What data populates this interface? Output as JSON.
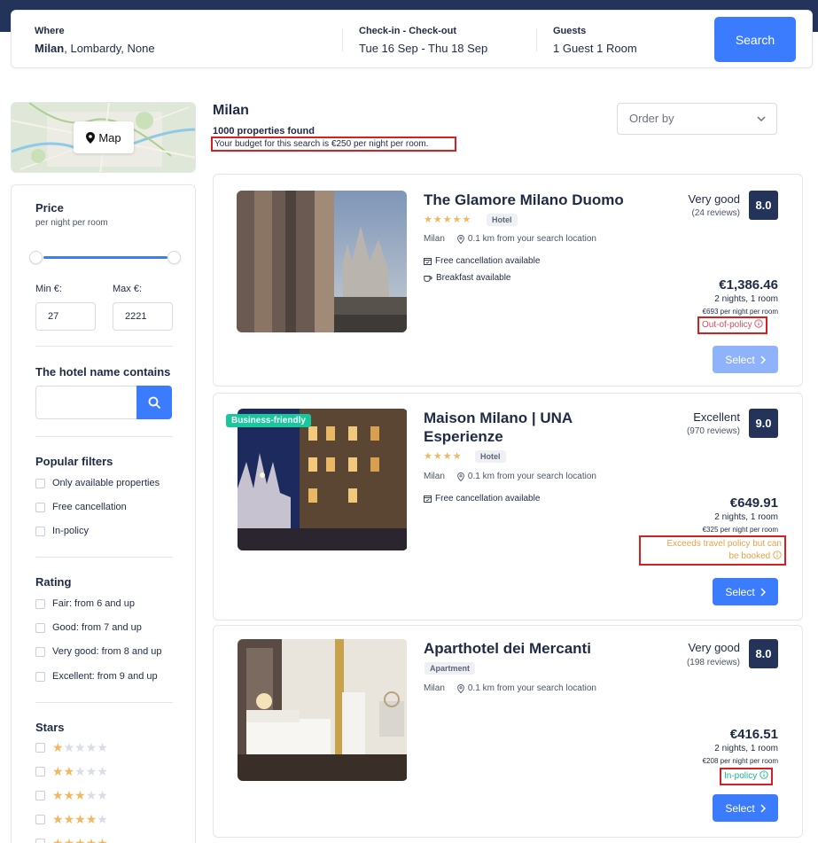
{
  "search": {
    "where_label": "Where",
    "where_city": "Milan",
    "where_rest": ", Lombardy, None",
    "dates_label": "Check-in - Check-out",
    "dates_value": "Tue 16 Sep - Thu 18 Sep",
    "guests_label": "Guests",
    "guests_value": "1 Guest 1 Room",
    "search_button": "Search"
  },
  "map": {
    "button_label": "Map",
    "icon": "map-pin-icon"
  },
  "filters": {
    "price_title": "Price",
    "price_sub": "per night per room",
    "min_label": "Min €:",
    "max_label": "Max €:",
    "min_value": "27",
    "max_value": "2221",
    "hotel_name_title": "The hotel name contains",
    "hotel_name_value": "",
    "popular_title": "Popular filters",
    "popular": [
      "Only available properties",
      "Free cancellation",
      "In-policy"
    ],
    "rating_title": "Rating",
    "ratings": [
      "Fair: from 6 and up",
      "Good: from 7 and up",
      "Very good: from 8 and up",
      "Excellent: from 9 and up"
    ],
    "stars_title": "Stars",
    "stars_levels": [
      1,
      2,
      3,
      4,
      5
    ]
  },
  "results": {
    "city": "Milan",
    "found": "1000 properties found",
    "budget_note": "Your budget for this search is €250 per night per room.",
    "order_by": "Order by"
  },
  "hotels": [
    {
      "name": "The Glamore Milano Duomo",
      "name_line2": "",
      "stars": 5,
      "type": "Hotel",
      "city": "Milan",
      "distance": "0.1 km from your search location",
      "features": [
        "Free cancellation available",
        "Breakfast available"
      ],
      "rating_word": "Very good",
      "reviews": "(24 reviews)",
      "score": "8.0",
      "total": "€1,386.46",
      "nights": "2 nights, 1 room",
      "per_night": "€693 per night per room",
      "policy_line1": "Out-of-policy",
      "policy_line2": "",
      "policy_status": "out",
      "select_label": "Select",
      "badge": ""
    },
    {
      "name": "Maison Milano | UNA",
      "name_line2": "Esperienze",
      "stars": 4,
      "type": "Hotel",
      "city": "Milan",
      "distance": "0.1 km from your search location",
      "features": [
        "Free cancellation available"
      ],
      "rating_word": "Excellent",
      "reviews": "(970 reviews)",
      "score": "9.0",
      "total": "€649.91",
      "nights": "2 nights, 1 room",
      "per_night": "€325 per night per room",
      "policy_line1": "Exceeds travel policy but can",
      "policy_line2": "be booked",
      "policy_status": "exceeds",
      "select_label": "Select",
      "badge": "Business-friendly"
    },
    {
      "name": "Aparthotel dei Mercanti",
      "name_line2": "",
      "stars": 0,
      "type": "Apartment",
      "city": "Milan",
      "distance": "0.1 km from your search location",
      "features": [],
      "rating_word": "Very good",
      "reviews": "(198 reviews)",
      "score": "8.0",
      "total": "€416.51",
      "nights": "2 nights, 1 room",
      "per_night": "€208 per night per room",
      "policy_line1": "In-policy",
      "policy_line2": "",
      "policy_status": "in",
      "select_label": "Select",
      "badge": ""
    }
  ],
  "colors": {
    "topbar": "#24335a",
    "accent": "#3b7cff",
    "score_bg": "#24335a",
    "star": "#f0b860",
    "out_of_policy": "#e04a5a",
    "exceeds_policy": "#e8a04a",
    "in_policy": "#19b394",
    "badge": "#18c79b"
  }
}
